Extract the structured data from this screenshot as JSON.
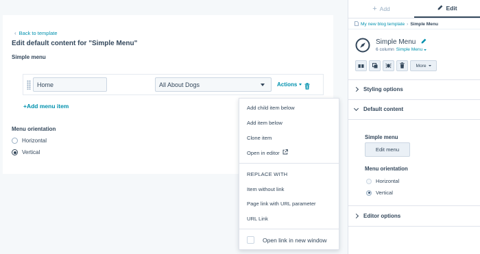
{
  "editor": {
    "back_link": "Back to template",
    "heading": "Edit default content for \"Simple Menu\"",
    "section_label": "Simple menu",
    "menu_item": {
      "name_value": "Home",
      "page_select_value": "All About Dogs",
      "actions_label": "Actions"
    },
    "add_menu_item": "+Add menu item",
    "orientation_label": "Menu orientation",
    "orientation_options": [
      {
        "label": "Horizontal",
        "checked": false
      },
      {
        "label": "Vertical",
        "checked": true
      }
    ]
  },
  "actions_menu": {
    "items": [
      "Add child item below",
      "Add item below",
      "Clone item",
      "Open in editor"
    ],
    "replace_heading": "REPLACE WITH",
    "replace_items": [
      "Item without link",
      "Page link with URL parameter",
      "URL Link"
    ],
    "checkbox_label": "Open link in new window",
    "checkbox_checked": false
  },
  "sidebar": {
    "tabs": {
      "add": "Add",
      "edit": "Edit",
      "active": "edit"
    },
    "breadcrumb": {
      "parent": "My new blog template",
      "current": "Simple Menu"
    },
    "module": {
      "title": "Simple Menu",
      "sub_prefix": "6 column",
      "sub_link": "Simple Menu"
    },
    "toolbar": {
      "icons": [
        "swap-icon",
        "duplicate-icon",
        "bug-icon",
        "trash-icon"
      ],
      "more_label": "More"
    },
    "accordions": {
      "styling": "Styling options",
      "default_content": "Default content",
      "editor": "Editor options"
    },
    "content": {
      "simple_menu_label": "Simple menu",
      "edit_menu_button": "Edit menu",
      "orientation_label": "Menu orientation",
      "orientation_options": [
        {
          "label": "Horizontal",
          "checked": false
        },
        {
          "label": "Vertical",
          "checked": true
        }
      ]
    }
  },
  "colors": {
    "link": "#0091ae",
    "text": "#33475b",
    "background": "#f5f8fa",
    "border": "#dfe3eb"
  }
}
